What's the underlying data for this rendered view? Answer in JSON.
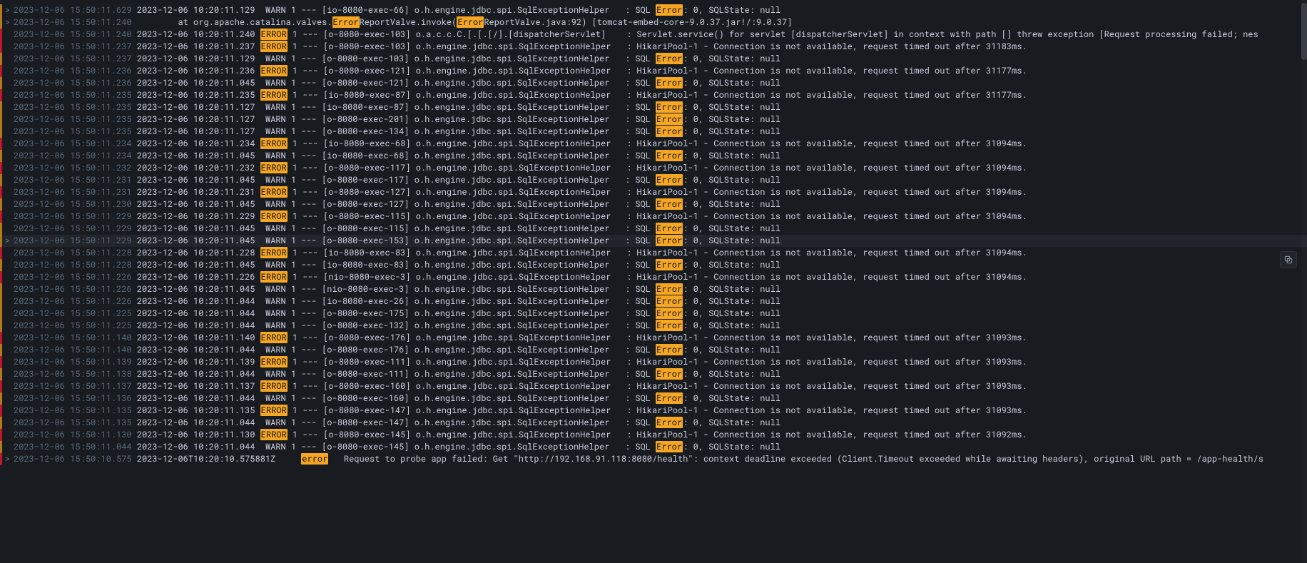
{
  "highlight_match": "Error",
  "colors": {
    "bg": "#181b1f",
    "text": "#ccccdc",
    "ts": "#5a6a7a",
    "warn_bar": "#b57a14",
    "error_bar": "#c4162a",
    "highlight_bg": "#f5a623",
    "highlight_fg": "#111111"
  },
  "logs": [
    {
      "ts": "2023-12-06 15:50:11.629",
      "lvl": "warn",
      "expandable": true,
      "body": "2023-12-06 10:20:11.129  WARN 1 --- [io-8080-exec-66] o.h.engine.jdbc.spi.SqlExceptionHelper   : SQL Error: 0, SQLState: null"
    },
    {
      "ts": "2023-12-06 15:50:11.240",
      "lvl": "warn",
      "expandable": true,
      "body": "        at org.apache.catalina.valves.ErrorReportValve.invoke(ErrorReportValve.java:92) [tomcat-embed-core-9.0.37.jar!/:9.0.37]"
    },
    {
      "ts": "2023-12-06 15:50:11.240",
      "lvl": "error",
      "expandable": false,
      "body": "2023-12-06 10:20:11.240 ERROR 1 --- [o-8080-exec-103] o.a.c.c.C.[.[.[/].[dispatcherServlet]    : Servlet.service() for servlet [dispatcherServlet] in context with path [] threw exception [Request processing failed; nes"
    },
    {
      "ts": "2023-12-06 15:50:11.237",
      "lvl": "error",
      "expandable": false,
      "body": "2023-12-06 10:20:11.237 ERROR 1 --- [o-8080-exec-103] o.h.engine.jdbc.spi.SqlExceptionHelper   : HikariPool-1 - Connection is not available, request timed out after 31183ms."
    },
    {
      "ts": "2023-12-06 15:50:11.237",
      "lvl": "warn",
      "expandable": false,
      "body": "2023-12-06 10:20:11.129  WARN 1 --- [o-8080-exec-103] o.h.engine.jdbc.spi.SqlExceptionHelper   : SQL Error: 0, SQLState: null"
    },
    {
      "ts": "2023-12-06 15:50:11.236",
      "lvl": "error",
      "expandable": false,
      "body": "2023-12-06 10:20:11.236 ERROR 1 --- [o-8080-exec-121] o.h.engine.jdbc.spi.SqlExceptionHelper   : HikariPool-1 - Connection is not available, request timed out after 31177ms."
    },
    {
      "ts": "2023-12-06 15:50:11.236",
      "lvl": "warn",
      "expandable": false,
      "body": "2023-12-06 10:20:11.045  WARN 1 --- [o-8080-exec-121] o.h.engine.jdbc.spi.SqlExceptionHelper   : SQL Error: 0, SQLState: null"
    },
    {
      "ts": "2023-12-06 15:50:11.235",
      "lvl": "error",
      "expandable": false,
      "body": "2023-12-06 10:20:11.235 ERROR 1 --- [io-8080-exec-87] o.h.engine.jdbc.spi.SqlExceptionHelper   : HikariPool-1 - Connection is not available, request timed out after 31177ms."
    },
    {
      "ts": "2023-12-06 15:50:11.235",
      "lvl": "warn",
      "expandable": false,
      "body": "2023-12-06 10:20:11.127  WARN 1 --- [io-8080-exec-87] o.h.engine.jdbc.spi.SqlExceptionHelper   : SQL Error: 0, SQLState: null"
    },
    {
      "ts": "2023-12-06 15:50:11.235",
      "lvl": "warn",
      "expandable": false,
      "body": "2023-12-06 10:20:11.127  WARN 1 --- [o-8080-exec-201] o.h.engine.jdbc.spi.SqlExceptionHelper   : SQL Error: 0, SQLState: null"
    },
    {
      "ts": "2023-12-06 15:50:11.235",
      "lvl": "warn",
      "expandable": false,
      "body": "2023-12-06 10:20:11.127  WARN 1 --- [o-8080-exec-134] o.h.engine.jdbc.spi.SqlExceptionHelper   : SQL Error: 0, SQLState: null"
    },
    {
      "ts": "2023-12-06 15:50:11.234",
      "lvl": "error",
      "expandable": false,
      "body": "2023-12-06 10:20:11.234 ERROR 1 --- [io-8080-exec-68] o.h.engine.jdbc.spi.SqlExceptionHelper   : HikariPool-1 - Connection is not available, request timed out after 31094ms."
    },
    {
      "ts": "2023-12-06 15:50:11.234",
      "lvl": "warn",
      "expandable": false,
      "body": "2023-12-06 10:20:11.045  WARN 1 --- [io-8080-exec-68] o.h.engine.jdbc.spi.SqlExceptionHelper   : SQL Error: 0, SQLState: null"
    },
    {
      "ts": "2023-12-06 15:50:11.232",
      "lvl": "error",
      "expandable": false,
      "body": "2023-12-06 10:20:11.232 ERROR 1 --- [o-8080-exec-117] o.h.engine.jdbc.spi.SqlExceptionHelper   : HikariPool-1 - Connection is not available, request timed out after 31094ms."
    },
    {
      "ts": "2023-12-06 15:50:11.231",
      "lvl": "warn",
      "expandable": false,
      "body": "2023-12-06 10:20:11.045  WARN 1 --- [o-8080-exec-117] o.h.engine.jdbc.spi.SqlExceptionHelper   : SQL Error: 0, SQLState: null"
    },
    {
      "ts": "2023-12-06 15:50:11.231",
      "lvl": "error",
      "expandable": false,
      "body": "2023-12-06 10:20:11.231 ERROR 1 --- [o-8080-exec-127] o.h.engine.jdbc.spi.SqlExceptionHelper   : HikariPool-1 - Connection is not available, request timed out after 31094ms."
    },
    {
      "ts": "2023-12-06 15:50:11.230",
      "lvl": "warn",
      "expandable": false,
      "body": "2023-12-06 10:20:11.045  WARN 1 --- [o-8080-exec-127] o.h.engine.jdbc.spi.SqlExceptionHelper   : SQL Error: 0, SQLState: null"
    },
    {
      "ts": "2023-12-06 15:50:11.229",
      "lvl": "error",
      "expandable": false,
      "body": "2023-12-06 10:20:11.229 ERROR 1 --- [o-8080-exec-115] o.h.engine.jdbc.spi.SqlExceptionHelper   : HikariPool-1 - Connection is not available, request timed out after 31094ms."
    },
    {
      "ts": "2023-12-06 15:50:11.229",
      "lvl": "warn",
      "expandable": false,
      "body": "2023-12-06 10:20:11.045  WARN 1 --- [o-8080-exec-115] o.h.engine.jdbc.spi.SqlExceptionHelper   : SQL Error: 0, SQLState: null"
    },
    {
      "ts": "2023-12-06 15:50:11.229",
      "lvl": "warn",
      "expandable": true,
      "hovered": true,
      "body": "2023-12-06 10:20:11.045  WARN 1 --- [o-8080-exec-153] o.h.engine.jdbc.spi.SqlExceptionHelper   : SQL Error: 0, SQLState: null"
    },
    {
      "ts": "2023-12-06 15:50:11.228",
      "lvl": "error",
      "expandable": false,
      "body": "2023-12-06 10:20:11.228 ERROR 1 --- [io-8080-exec-83] o.h.engine.jdbc.spi.SqlExceptionHelper   : HikariPool-1 - Connection is not available, request timed out after 31094ms."
    },
    {
      "ts": "2023-12-06 15:50:11.228",
      "lvl": "warn",
      "expandable": false,
      "body": "2023-12-06 10:20:11.045  WARN 1 --- [io-8080-exec-83] o.h.engine.jdbc.spi.SqlExceptionHelper   : SQL Error: 0, SQLState: null"
    },
    {
      "ts": "2023-12-06 15:50:11.226",
      "lvl": "error",
      "expandable": false,
      "body": "2023-12-06 10:20:11.226 ERROR 1 --- [nio-8080-exec-3] o.h.engine.jdbc.spi.SqlExceptionHelper   : HikariPool-1 - Connection is not available, request timed out after 31094ms."
    },
    {
      "ts": "2023-12-06 15:50:11.226",
      "lvl": "warn",
      "expandable": false,
      "body": "2023-12-06 10:20:11.045  WARN 1 --- [nio-8080-exec-3] o.h.engine.jdbc.spi.SqlExceptionHelper   : SQL Error: 0, SQLState: null"
    },
    {
      "ts": "2023-12-06 15:50:11.226",
      "lvl": "warn",
      "expandable": false,
      "body": "2023-12-06 10:20:11.044  WARN 1 --- [io-8080-exec-26] o.h.engine.jdbc.spi.SqlExceptionHelper   : SQL Error: 0, SQLState: null"
    },
    {
      "ts": "2023-12-06 15:50:11.225",
      "lvl": "warn",
      "expandable": false,
      "body": "2023-12-06 10:20:11.044  WARN 1 --- [o-8080-exec-175] o.h.engine.jdbc.spi.SqlExceptionHelper   : SQL Error: 0, SQLState: null"
    },
    {
      "ts": "2023-12-06 15:50:11.225",
      "lvl": "warn",
      "expandable": false,
      "body": "2023-12-06 10:20:11.044  WARN 1 --- [o-8080-exec-132] o.h.engine.jdbc.spi.SqlExceptionHelper   : SQL Error: 0, SQLState: null"
    },
    {
      "ts": "2023-12-06 15:50:11.140",
      "lvl": "error",
      "expandable": false,
      "body": "2023-12-06 10:20:11.140 ERROR 1 --- [o-8080-exec-176] o.h.engine.jdbc.spi.SqlExceptionHelper   : HikariPool-1 - Connection is not available, request timed out after 31093ms."
    },
    {
      "ts": "2023-12-06 15:50:11.140",
      "lvl": "warn",
      "expandable": false,
      "body": "2023-12-06 10:20:11.044  WARN 1 --- [o-8080-exec-176] o.h.engine.jdbc.spi.SqlExceptionHelper   : SQL Error: 0, SQLState: null"
    },
    {
      "ts": "2023-12-06 15:50:11.139",
      "lvl": "error",
      "expandable": false,
      "body": "2023-12-06 10:20:11.139 ERROR 1 --- [o-8080-exec-111] o.h.engine.jdbc.spi.SqlExceptionHelper   : HikariPool-1 - Connection is not available, request timed out after 31093ms."
    },
    {
      "ts": "2023-12-06 15:50:11.138",
      "lvl": "warn",
      "expandable": false,
      "body": "2023-12-06 10:20:11.044  WARN 1 --- [o-8080-exec-111] o.h.engine.jdbc.spi.SqlExceptionHelper   : SQL Error: 0, SQLState: null"
    },
    {
      "ts": "2023-12-06 15:50:11.137",
      "lvl": "error",
      "expandable": false,
      "body": "2023-12-06 10:20:11.137 ERROR 1 --- [o-8080-exec-160] o.h.engine.jdbc.spi.SqlExceptionHelper   : HikariPool-1 - Connection is not available, request timed out after 31093ms."
    },
    {
      "ts": "2023-12-06 15:50:11.136",
      "lvl": "warn",
      "expandable": false,
      "body": "2023-12-06 10:20:11.044  WARN 1 --- [o-8080-exec-160] o.h.engine.jdbc.spi.SqlExceptionHelper   : SQL Error: 0, SQLState: null"
    },
    {
      "ts": "2023-12-06 15:50:11.135",
      "lvl": "error",
      "expandable": false,
      "body": "2023-12-06 10:20:11.135 ERROR 1 --- [o-8080-exec-147] o.h.engine.jdbc.spi.SqlExceptionHelper   : HikariPool-1 - Connection is not available, request timed out after 31093ms."
    },
    {
      "ts": "2023-12-06 15:50:11.135",
      "lvl": "warn",
      "expandable": false,
      "body": "2023-12-06 10:20:11.044  WARN 1 --- [o-8080-exec-147] o.h.engine.jdbc.spi.SqlExceptionHelper   : SQL Error: 0, SQLState: null"
    },
    {
      "ts": "2023-12-06 15:50:11.130",
      "lvl": "error",
      "expandable": false,
      "body": "2023-12-06 10:20:11.130 ERROR 1 --- [o-8080-exec-145] o.h.engine.jdbc.spi.SqlExceptionHelper   : HikariPool-1 - Connection is not available, request timed out after 31092ms."
    },
    {
      "ts": "2023-12-06 15:50:11.044",
      "lvl": "warn",
      "expandable": false,
      "body": "2023-12-06 10:20:11.044  WARN 1 --- [o-8080-exec-145] o.h.engine.jdbc.spi.SqlExceptionHelper   : SQL Error: 0, SQLState: null"
    },
    {
      "ts": "2023-12-06 15:50:10.575",
      "lvl": "error",
      "expandable": true,
      "body": "2023-12-06T10:20:10.575881Z     error   Request to probe app failed: Get \"http://192.168.91.118:8080/health\": context deadline exceeded (Client.Timeout exceeded while awaiting headers), original URL path = /app-health/s"
    }
  ],
  "copy_button": {
    "title": "Copy"
  }
}
